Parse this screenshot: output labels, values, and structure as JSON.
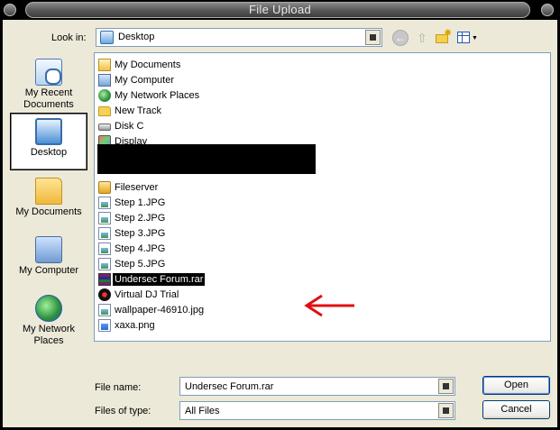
{
  "window": {
    "title": "File Upload"
  },
  "lookin": {
    "label": "Look in:",
    "value": "Desktop"
  },
  "toolbar": {
    "back": "back-icon",
    "up": "up-folder-icon",
    "new_folder": "new-folder-icon",
    "views": "views-menu-icon"
  },
  "places": [
    {
      "label_line1": "My Recent",
      "label_line2": "Documents",
      "icon": "recent-documents-icon"
    },
    {
      "label_line1": "Desktop",
      "label_line2": "",
      "icon": "desktop-icon",
      "selected": true
    },
    {
      "label_line1": "My Documents",
      "label_line2": "",
      "icon": "my-documents-icon"
    },
    {
      "label_line1": "My Computer",
      "label_line2": "",
      "icon": "my-computer-icon"
    },
    {
      "label_line1": "My Network",
      "label_line2": "Places",
      "icon": "my-network-places-icon"
    }
  ],
  "files": [
    {
      "name": "My Documents",
      "icon": "my-documents-icon"
    },
    {
      "name": "My Computer",
      "icon": "my-computer-icon"
    },
    {
      "name": "My Network Places",
      "icon": "network-places-icon"
    },
    {
      "name": "New Track",
      "icon": "folder-icon"
    },
    {
      "name": "Disk C",
      "icon": "drive-icon"
    },
    {
      "name": "Display",
      "icon": "display-icon"
    },
    {
      "name": "Fileserver",
      "icon": "fileserver-icon"
    },
    {
      "name": "Step 1.JPG",
      "icon": "jpg-file-icon"
    },
    {
      "name": "Step 2.JPG",
      "icon": "jpg-file-icon"
    },
    {
      "name": "Step 3.JPG",
      "icon": "jpg-file-icon"
    },
    {
      "name": "Step 4.JPG",
      "icon": "jpg-file-icon"
    },
    {
      "name": "Step 5.JPG",
      "icon": "jpg-file-icon"
    },
    {
      "name": "Undersec Forum.rar",
      "icon": "rar-archive-icon",
      "selected": true
    },
    {
      "name": "Virtual DJ Trial",
      "icon": "virtual-dj-icon"
    },
    {
      "name": "wallpaper-46910.jpg",
      "icon": "jpg-file-icon"
    },
    {
      "name": "xaxa.png",
      "icon": "png-file-icon"
    }
  ],
  "filename": {
    "label": "File name:",
    "value": "Undersec Forum.rar"
  },
  "filetype": {
    "label": "Files of type:",
    "value": "All Files"
  },
  "buttons": {
    "open": "Open",
    "cancel": "Cancel"
  },
  "colors": {
    "selection": "#000000",
    "annotation_arrow": "#e01010",
    "dialog_bg": "#ece9d8"
  }
}
